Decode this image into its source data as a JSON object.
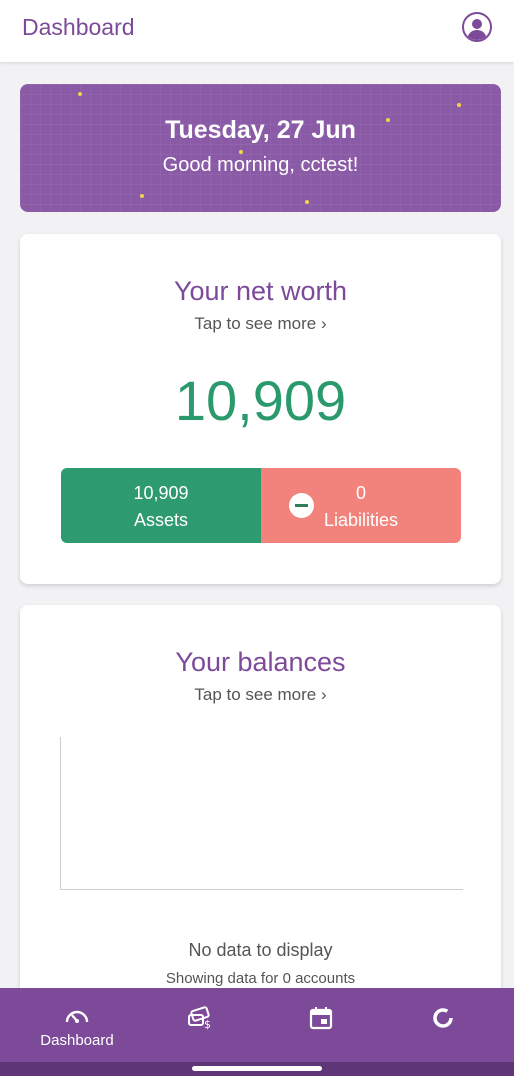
{
  "header": {
    "title": "Dashboard",
    "profile_icon": "profile-icon"
  },
  "greeting": {
    "date": "Tuesday, 27 Jun",
    "message": "Good morning, cctest!"
  },
  "net_worth": {
    "title": "Your net worth",
    "subtitle": "Tap to see more ›",
    "value": "10,909",
    "assets_value": "10,909",
    "assets_label": "Assets",
    "liabilities_value": "0",
    "liabilities_label": "Liabilities",
    "operator_icon": "minus-icon"
  },
  "balances": {
    "title": "Your balances",
    "subtitle": "Tap to see more ›",
    "empty_text": "No data to display",
    "footnote": "Showing data for 0 accounts"
  },
  "bottom_nav": {
    "items": [
      {
        "label": "Dashboard",
        "icon": "speedometer-icon",
        "active": true
      },
      {
        "label": "",
        "icon": "money-icon"
      },
      {
        "label": "",
        "icon": "calendar-icon"
      },
      {
        "label": "",
        "icon": "donut-chart-icon"
      }
    ]
  },
  "colors": {
    "brand_purple": "#7d4a99",
    "banner_purple": "#8a5aa6",
    "assets_green": "#2e9a6f",
    "liabilities_red": "#f2837c",
    "networth_green": "#2a9a6d"
  }
}
